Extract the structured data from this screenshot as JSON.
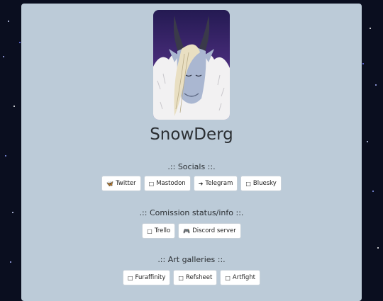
{
  "profile": {
    "name": "SnowDerg",
    "avatar_desc": "dragon-avatar"
  },
  "sections": [
    {
      "title": ".:: Socials ::.",
      "links": [
        {
          "icon": "butterfly-icon",
          "glyph": "🦋",
          "label": "Twitter"
        },
        {
          "icon": "mastodon-icon",
          "glyph": "□",
          "label": "Mastodon"
        },
        {
          "icon": "telegram-icon",
          "glyph": "➔",
          "label": "Telegram"
        },
        {
          "icon": "bluesky-icon",
          "glyph": "□",
          "label": "Bluesky"
        }
      ]
    },
    {
      "title": ".:: Comission status/info ::.",
      "links": [
        {
          "icon": "trello-icon",
          "glyph": "□",
          "label": "Trello"
        },
        {
          "icon": "discord-icon",
          "glyph": "🎮",
          "label": "Discord server"
        }
      ]
    },
    {
      "title": ".:: Art galleries ::.",
      "links": [
        {
          "icon": "furaffinity-icon",
          "glyph": "□",
          "label": "Furaffinity"
        },
        {
          "icon": "refsheet-icon",
          "glyph": "□",
          "label": "Refsheet"
        },
        {
          "icon": "artfight-icon",
          "glyph": "□",
          "label": "Artfight"
        }
      ]
    }
  ]
}
